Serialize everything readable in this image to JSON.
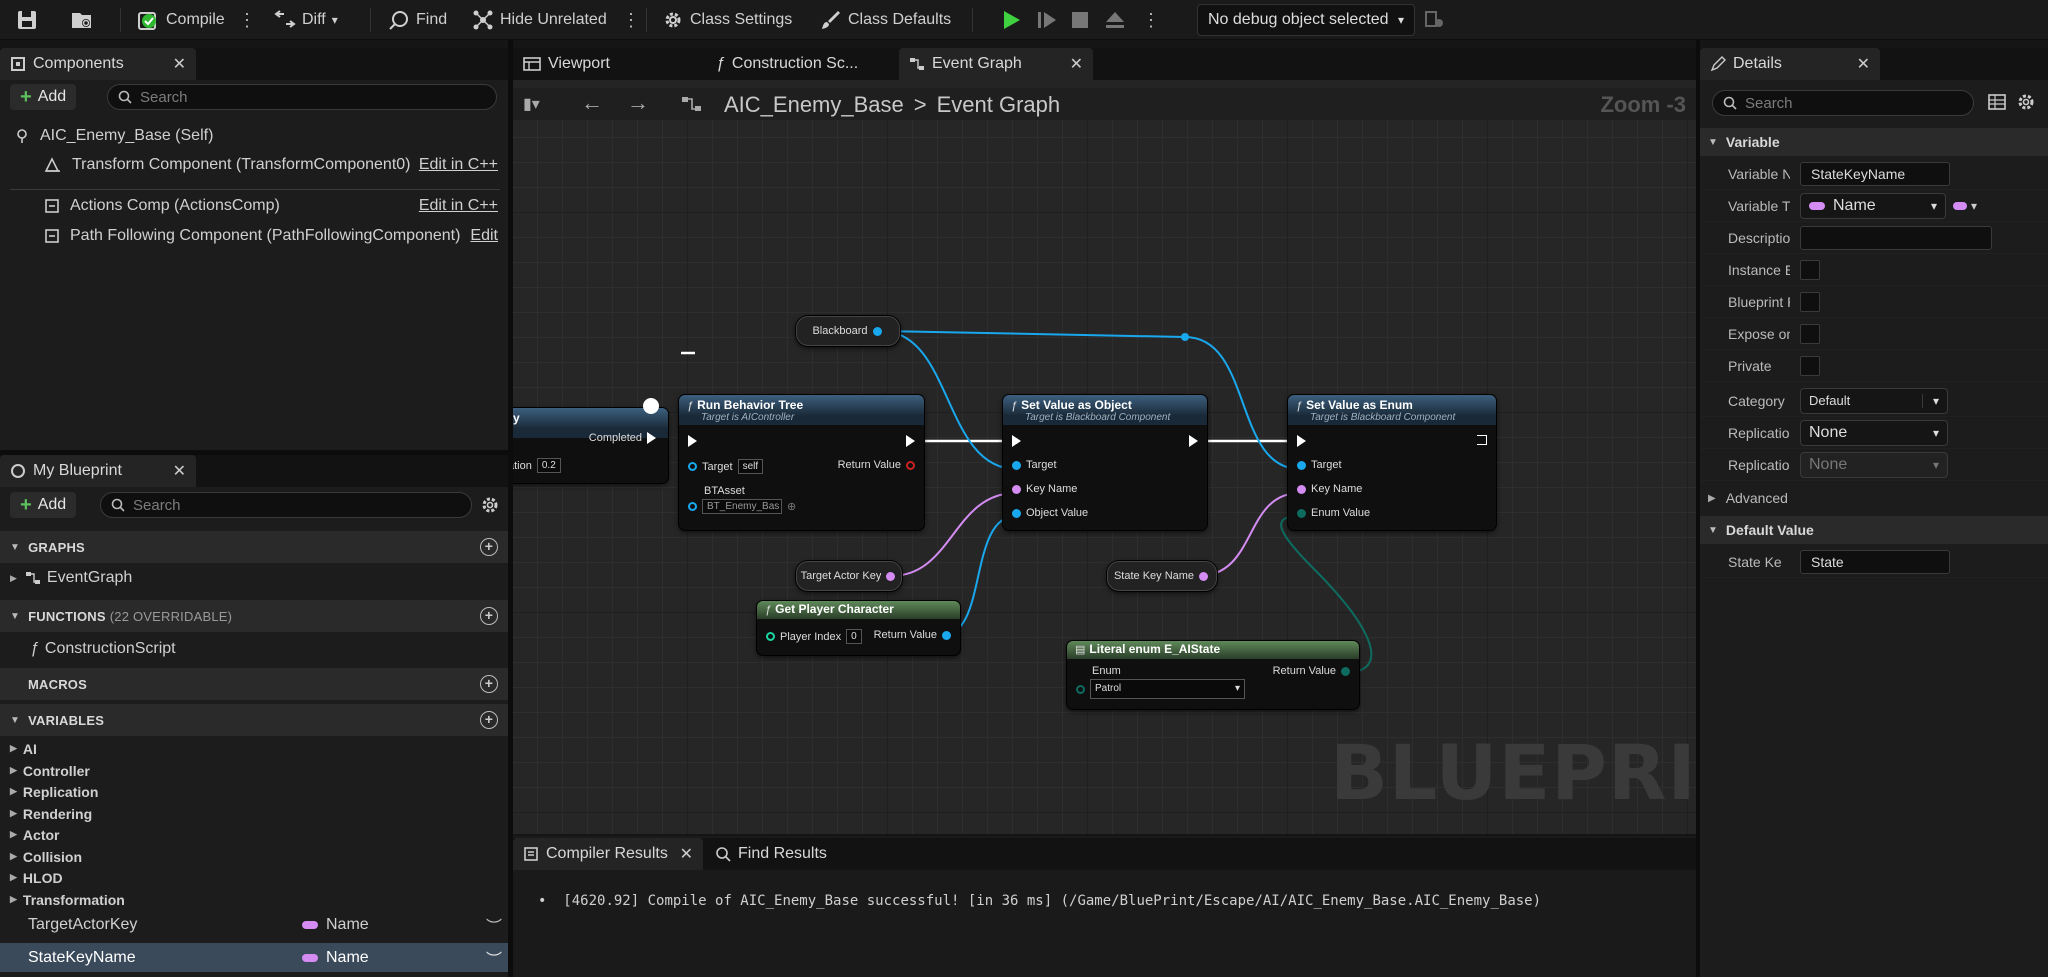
{
  "toolbar": {
    "compile": "Compile",
    "diff": "Diff",
    "find": "Find",
    "hide_unrelated": "Hide Unrelated",
    "class_settings": "Class Settings",
    "class_defaults": "Class Defaults",
    "debug_object": "No debug object selected"
  },
  "components": {
    "tab": "Components",
    "add": "Add",
    "search_placeholder": "Search",
    "self": "AIC_Enemy_Base (Self)",
    "items": [
      {
        "label": "Transform Component (TransformComponent0)",
        "action": "Edit in C++"
      },
      {
        "label": "Actions Comp (ActionsComp)",
        "action": "Edit in C++"
      },
      {
        "label": "Path Following Component (PathFollowingComponent)",
        "action": "Edit"
      }
    ]
  },
  "my_blueprint": {
    "tab": "My Blueprint",
    "add": "Add",
    "search_placeholder": "Search",
    "graphs_header": "GRAPHS",
    "graph_item": "EventGraph",
    "functions_header": "FUNCTIONS",
    "functions_note": "(22 OVERRIDABLE)",
    "function_item": "ConstructionScript",
    "macros_header": "MACROS",
    "variables_header": "VARIABLES",
    "categories": [
      "AI",
      "Controller",
      "Replication",
      "Rendering",
      "Actor",
      "Collision",
      "HLOD",
      "Transformation"
    ],
    "variables": [
      {
        "name": "TargetActorKey",
        "type": "Name"
      },
      {
        "name": "StateKeyName",
        "type": "Name"
      }
    ]
  },
  "editor_tabs": {
    "viewport": "Viewport",
    "construction": "Construction Sc...",
    "event_graph": "Event Graph"
  },
  "breadcrumb": {
    "root": "AIC_Enemy_Base",
    "sep": ">",
    "current": "Event Graph",
    "zoom": "Zoom -3"
  },
  "graph": {
    "watermark": "BLUEPRINT",
    "partial_node": {
      "title": "y",
      "completed": "Completed",
      "pin_label": "ation",
      "pin_value": "0.2"
    },
    "blackboard": "Blackboard",
    "run_bt": {
      "title": "Run Behavior Tree",
      "subtitle": "Target is AIController",
      "target": "Target",
      "target_value": "self",
      "return_value": "Return Value",
      "btasset": "BTAsset",
      "btasset_value": "BT_Enemy_Bas"
    },
    "set_obj": {
      "title": "Set Value as Object",
      "subtitle": "Target is Blackboard Component",
      "target": "Target",
      "key_name": "Key Name",
      "object_value": "Object Value"
    },
    "set_enum": {
      "title": "Set Value as Enum",
      "subtitle": "Target is Blackboard Component",
      "target": "Target",
      "key_name": "Key Name",
      "enum_value": "Enum Value"
    },
    "target_actor_key": "Target Actor Key",
    "state_key_name": "State Key Name",
    "get_player": {
      "title": "Get Player Character",
      "player_index": "Player Index",
      "player_index_value": "0",
      "return_value": "Return Value"
    },
    "literal_enum": {
      "title": "Literal enum E_AIState",
      "enum": "Enum",
      "enum_value": "Patrol",
      "return_value": "Return Value"
    }
  },
  "bottom": {
    "tab_compiler": "Compiler Results",
    "tab_find": "Find Results",
    "message": "[4620.92] Compile of AIC_Enemy_Base successful! [in 36 ms] (/Game/BluePrint/Escape/AI/AIC_Enemy_Base.AIC_Enemy_Base)"
  },
  "details": {
    "tab": "Details",
    "search_placeholder": "Search",
    "variable_header": "Variable",
    "rows": {
      "var_name_label": "Variable N",
      "var_name_value": "StateKeyName",
      "var_type_label": "Variable T",
      "var_type_value": "Name",
      "description_label": "Descriptio",
      "instance_label": "Instance E",
      "blueprint_label": "Blueprint R",
      "expose_label": "Expose on",
      "private_label": "Private",
      "category_label": "Category",
      "category_value": "Default",
      "replication_label": "Replicatio",
      "replication_value": "None",
      "replication2_label": "Replicatio",
      "replication2_value": "None"
    },
    "advanced": "Advanced",
    "default_header": "Default Value",
    "default_label": "State Ke",
    "default_value": "State"
  },
  "colors": {
    "name_pin": "#d48cf2",
    "object_pin": "#19a8ee",
    "exec_pin": "#ffffff",
    "enum_pin": "#0d6b5f",
    "play": "#3fd13f"
  }
}
